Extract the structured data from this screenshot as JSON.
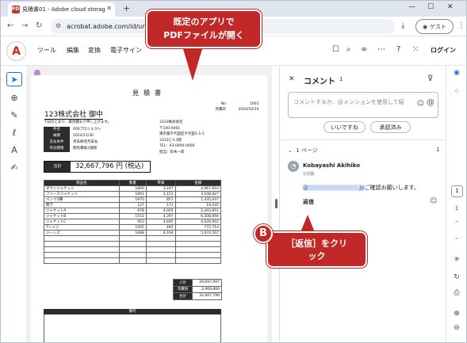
{
  "browser": {
    "tab_title": "見積書01 - Adobe cloud storag",
    "tab_icon": "PDF",
    "url": "acrobat.adobe.com/id/urn:a",
    "guest_label": "ゲスト"
  },
  "acrobat": {
    "menu": [
      "ツール",
      "編集",
      "変換",
      "電子サイン"
    ],
    "login": "ログイン"
  },
  "document": {
    "title": "見積書",
    "company": "123株式会社 御中",
    "no_label": "No",
    "no_value": "1001",
    "date_label": "見積日",
    "date_value": "2024/10/10",
    "intro": "下記のとおり、御見積もり申し上げます。",
    "info": [
      {
        "key": "件名",
        "value": "000プロジェクト"
      },
      {
        "key": "納期",
        "value": "2024/11/30"
      },
      {
        "key": "支払条件",
        "value": "月末締翌月末払"
      },
      {
        "key": "有効期限",
        "value": "御見積後2週間"
      }
    ],
    "sender": [
      "3333株式会社",
      "〒100-0001",
      "東京都千代田区千代田1-1-1",
      "3333ビル3階",
      "TEL：03-0000-0000",
      "担当：鈴木一郎"
    ],
    "total_label": "合計",
    "total_value": "32,667,796 円 (税込)",
    "table_headers": [
      "製品名",
      "数量",
      "単価",
      "金額"
    ],
    "rows": [
      [
        "ダウンジャケット",
        "1800",
        "3,247",
        "4,967,910"
      ],
      [
        "フリースジャケット",
        "1941",
        "2,151",
        "3,548,827"
      ],
      [
        "パンツ5種",
        "1970",
        "857",
        "1,435,047"
      ],
      [
        "靴下",
        "127",
        "171",
        "19,545"
      ],
      [
        "ジャケットA",
        "678",
        "4,005",
        "2,443,851"
      ],
      [
        "ジャケットB",
        "1551",
        "4,397",
        "6,508,694"
      ],
      [
        "ジャケットC",
        "953",
        "4,695",
        "4,026,902"
      ],
      [
        "Tシャツ",
        "1955",
        "465",
        "772,714"
      ],
      [
        "ジーンズ",
        "1688",
        "4,164",
        "5,974,507"
      ]
    ],
    "sums": [
      {
        "label": "小計",
        "value": "29,697,997"
      },
      {
        "label": "消費税",
        "value": "2,969,800"
      },
      {
        "label": "合計",
        "value": "32,667,796"
      }
    ],
    "remarks_label": "備考"
  },
  "comments": {
    "title": "コメント",
    "count": "1",
    "placeholder": "コメントするか、@メンションを使用して紹",
    "chip_like": "いいですね",
    "chip_approve": "承認済み",
    "page_header": "1 ページ",
    "page_count": "1",
    "author": "Kobayashi Akihiko",
    "time": "1分前",
    "mention_prefix": "@",
    "mention_suffix": ".jp",
    "body": "ご確認お願いします。",
    "reply": "返信"
  },
  "rail": {
    "page_current": "1",
    "page_total": "1"
  },
  "annotations": {
    "callout_top": "既定のアプリで\nPDFファイルが開く",
    "marker": "B",
    "callout_bottom": "［返信］をクリ\nック"
  },
  "colors": {
    "accent_red": "#c12929",
    "adobe_red": "#e21b1b",
    "link_blue": "#1a5fb4"
  }
}
